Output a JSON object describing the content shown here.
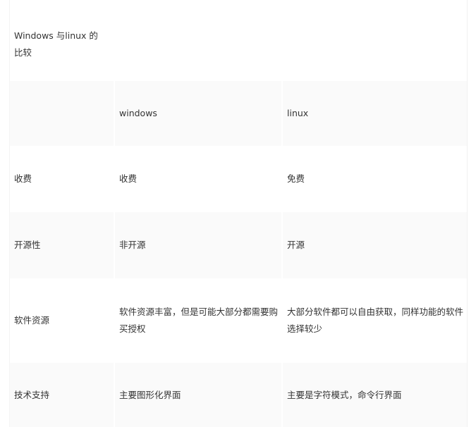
{
  "table": {
    "title": "Windows 与linux 的比较",
    "header": {
      "col1": "",
      "col2": "windows",
      "col3": "linux"
    },
    "rows": [
      {
        "feature": "收费",
        "windows": "收费",
        "linux": "免费"
      },
      {
        "feature": "开源性",
        "windows": "非开源",
        "linux": "开源"
      },
      {
        "feature": "软件资源",
        "windows": "软件资源丰富，但是可能大部分都需要购买授权",
        "linux": "大部分软件都可以自由获取，同样功能的软件选择较少"
      },
      {
        "feature": "技术支持",
        "windows": "主要图形化界面",
        "linux": "主要是字符模式，命令行界面"
      }
    ]
  }
}
